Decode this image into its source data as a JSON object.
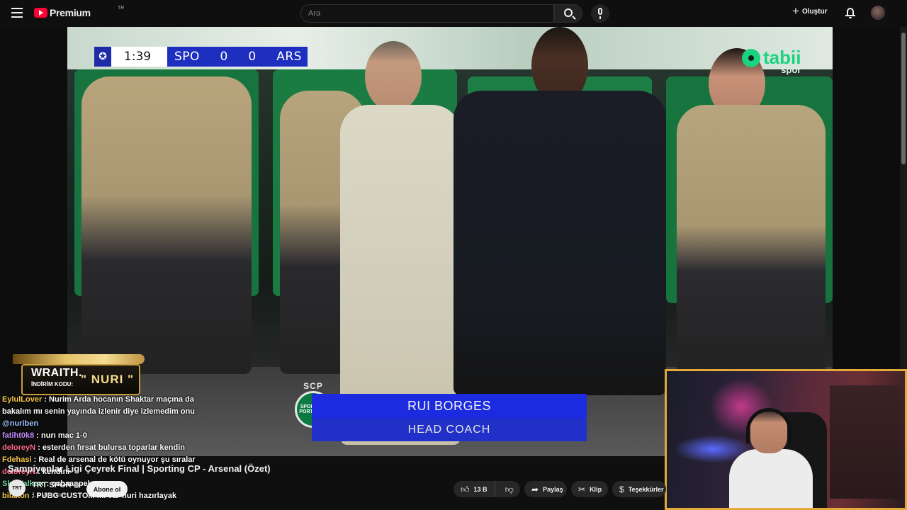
{
  "app": {
    "brand": "Premium",
    "region": "TR"
  },
  "search": {
    "placeholder": "Ara"
  },
  "header": {
    "create_label": "Oluştur"
  },
  "player": {
    "scorebug": {
      "clock": "1:39",
      "home": "SPO",
      "home_score": "0",
      "away_score": "0",
      "away": "ARS"
    },
    "broadcaster": {
      "name": "tabii",
      "sub": "spor"
    },
    "lower_third": {
      "club": "SCP",
      "crest_text": "SPORTING PORTUGAL",
      "name": "RUI BORGES",
      "role": "HEAD COACH"
    }
  },
  "sponsor": {
    "brand": "WRAITH.",
    "code_label": "İNDİRİM KODU:",
    "code": "\" NURI \""
  },
  "chat": {
    "messages": [
      {
        "user": "EylulLover",
        "text": "Nurim Arda hocanın Shaktar maçına da"
      },
      {
        "user": "",
        "text": "bakalım mı senin yayında izlenir diye izlemedim onu"
      },
      {
        "user": "@nuriben",
        "text": ""
      },
      {
        "user": "fatiht0k8",
        "text": "nurı mac 1-0"
      },
      {
        "user": "deloreyN",
        "text": "esterden fırsat bulursa toparlar kendin"
      },
      {
        "user": "Fdehasi",
        "text": "Real de arsenal de kötü oynuyor şu sıralar"
      },
      {
        "user": "deloreyN",
        "text": "kendini-"
      },
      {
        "user": "SkyWalkerr",
        "text": "ocbaappel"
      },
      {
        "user": "bilakon",
        "text": "PUBG CUSTOM mı var nuri hazırlayak"
      }
    ]
  },
  "video": {
    "title": "Şampiyonlar Ligi Çeyrek Final | Sporting CP - Arsenal (Özet)",
    "channel_name": "TRT SPOR",
    "channel_avatar_text": "TRT",
    "subscribers": "1,1 Mn abone",
    "subscribe_label": "Abone ol",
    "likes": "13 B",
    "share_label": "Paylaş",
    "clip_label": "Klip",
    "thanks_label": "Teşekkürler"
  },
  "colors": {
    "accent_red": "#ff0033",
    "webcam_border": "#e3a93a",
    "scorebug_blue": "#1e2fc0",
    "tabii_green": "#1bd37f"
  },
  "icons": [
    "menu-icon",
    "youtube-logo-icon",
    "search-icon",
    "mic-icon",
    "plus-icon",
    "bell-icon",
    "like-icon",
    "dislike-icon",
    "share-icon",
    "clip-icon",
    "thanks-icon",
    "champions-league-icon",
    "verified-icon"
  ]
}
